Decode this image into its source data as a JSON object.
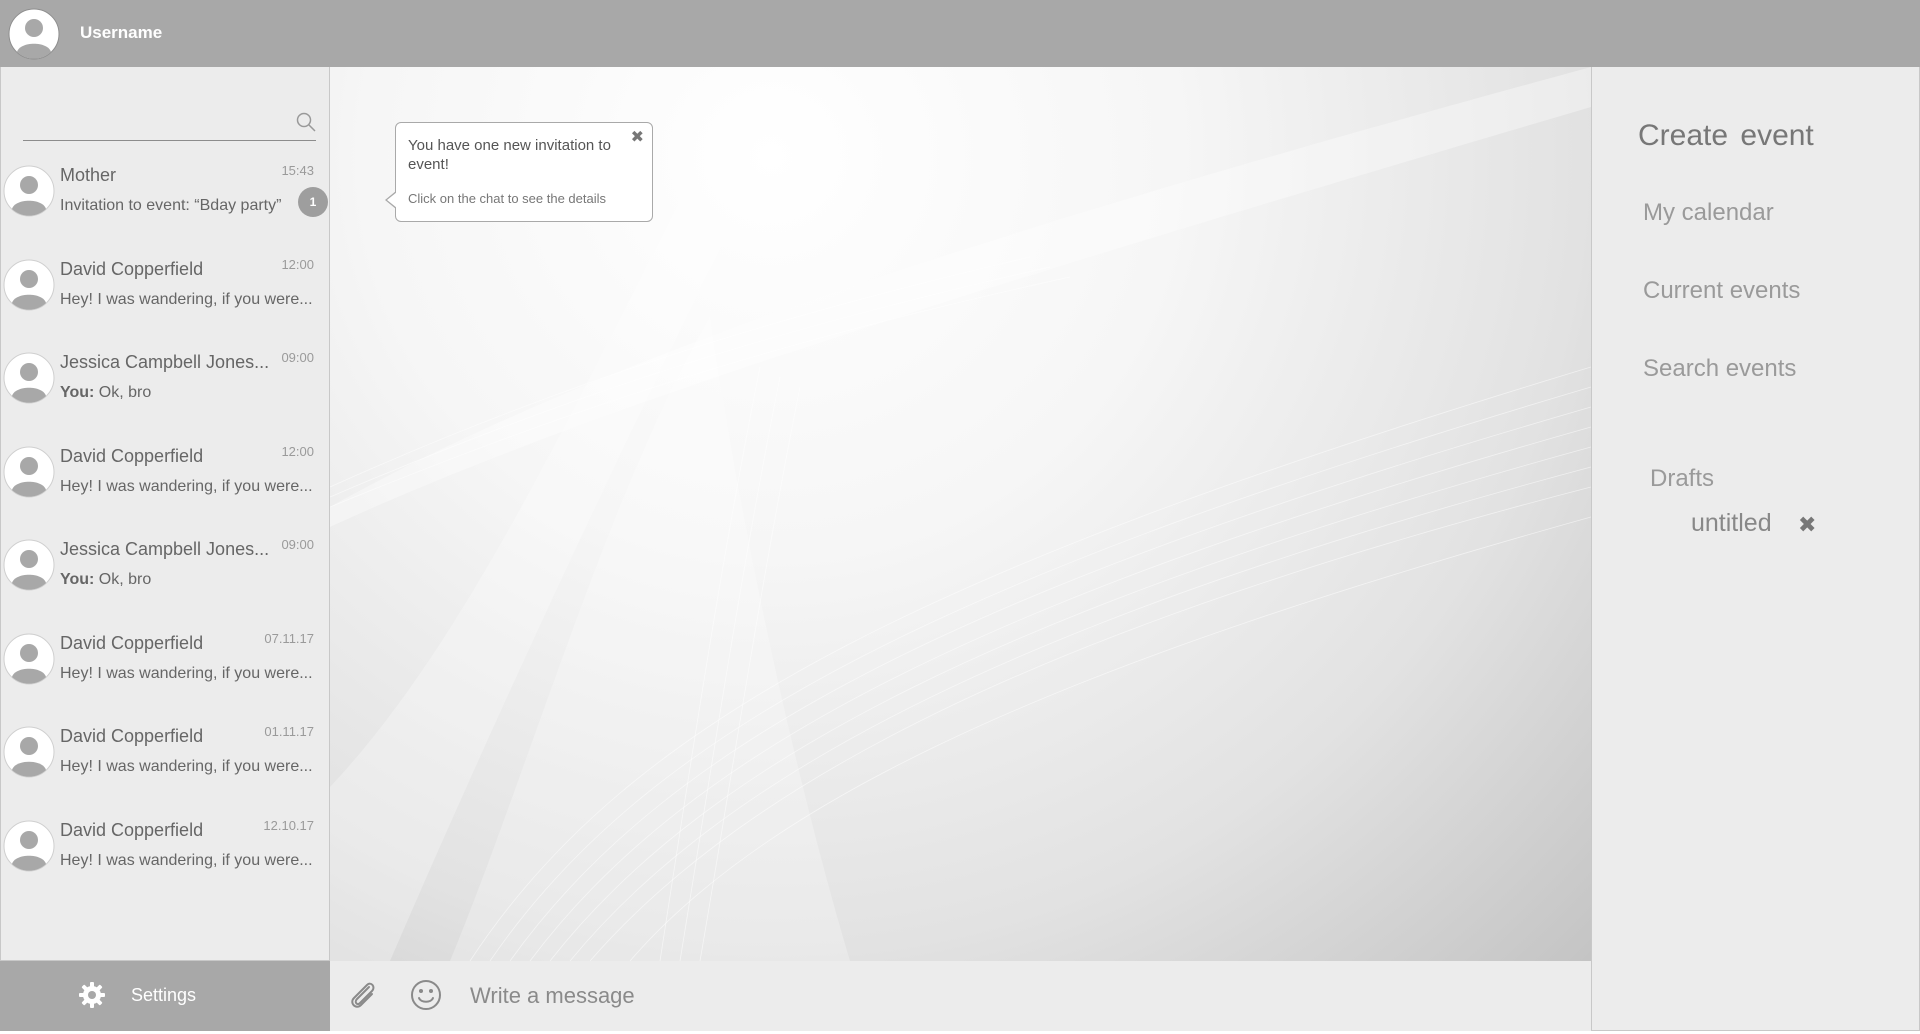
{
  "header": {
    "username": "Username"
  },
  "search": {
    "placeholder": ""
  },
  "chats": [
    {
      "name": "Mother",
      "time": "15:43",
      "prefix": "",
      "message": "Invitation to event: “Bday party”",
      "unread": "1"
    },
    {
      "name": "David Copperfield",
      "time": "12:00",
      "prefix": "",
      "message": "Hey! I was wandering, if you were..."
    },
    {
      "name": "Jessica Campbell Jones...",
      "time": "09:00",
      "prefix": "You:",
      "message": " Ok, bro"
    },
    {
      "name": "David Copperfield",
      "time": "12:00",
      "prefix": "",
      "message": "Hey! I was wandering, if you were..."
    },
    {
      "name": "Jessica Campbell Jones...",
      "time": "09:00",
      "prefix": "You:",
      "message": " Ok, bro"
    },
    {
      "name": "David Copperfield",
      "time": "07.11.17",
      "prefix": "",
      "message": "Hey! I was wandering, if you were..."
    },
    {
      "name": "David Copperfield",
      "time": "01.11.17",
      "prefix": "",
      "message": "Hey! I was wandering, if you were..."
    },
    {
      "name": "David Copperfield",
      "time": "12.10.17",
      "prefix": "",
      "message": "Hey! I was wandering, if you were..."
    }
  ],
  "settings": {
    "label": "Settings",
    "icon": "gear-icon"
  },
  "notification": {
    "title": "You have one new invitation to event!",
    "hint": "Click on the chat to see the details",
    "close": "✖"
  },
  "composer": {
    "placeholder": "Write a message",
    "attach_icon": "paperclip-icon",
    "emoji_icon": "smiley-icon"
  },
  "right_panel": {
    "create": "Create  event",
    "nav": [
      "My calendar",
      "Current events",
      "Search events"
    ],
    "drafts_label": "Drafts",
    "drafts": [
      {
        "name": "untitled",
        "close": "✖"
      }
    ]
  },
  "colors": {
    "topbar": "#a8a8a8",
    "panel": "#ececec",
    "badge": "#9e9e9e"
  }
}
